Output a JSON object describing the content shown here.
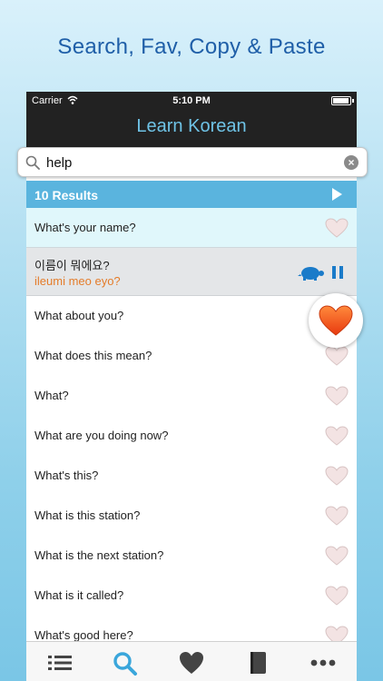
{
  "headline": "Search, Fav, Copy & Paste",
  "status_bar": {
    "carrier": "Carrier",
    "time": "5:10 PM"
  },
  "nav": {
    "title": "Learn Korean"
  },
  "search": {
    "value": "help",
    "clear_symbol": "×"
  },
  "results": {
    "count_label": "10 Results"
  },
  "rows": [
    {
      "text": "What's your name?"
    },
    {
      "text": "이름이 뭐에요?",
      "romanization": "ileumi meo eyo?"
    },
    {
      "text": "What about you?"
    },
    {
      "text": "What does this mean?"
    },
    {
      "text": "What?"
    },
    {
      "text": "What are you doing now?"
    },
    {
      "text": "What's this?"
    },
    {
      "text": "What is this station?"
    },
    {
      "text": "What is the next station?"
    },
    {
      "text": "What is it called?"
    },
    {
      "text": "What's good here?"
    }
  ],
  "tabs": [
    "list-icon",
    "search-icon",
    "heart-icon",
    "book-icon",
    "more-icon"
  ],
  "colors": {
    "accent": "#5ab4de",
    "heading": "#1f5fa8",
    "romanization": "#e47c2a",
    "active_tab": "#3aa6db",
    "heart_favorite": "#f25a1b"
  }
}
